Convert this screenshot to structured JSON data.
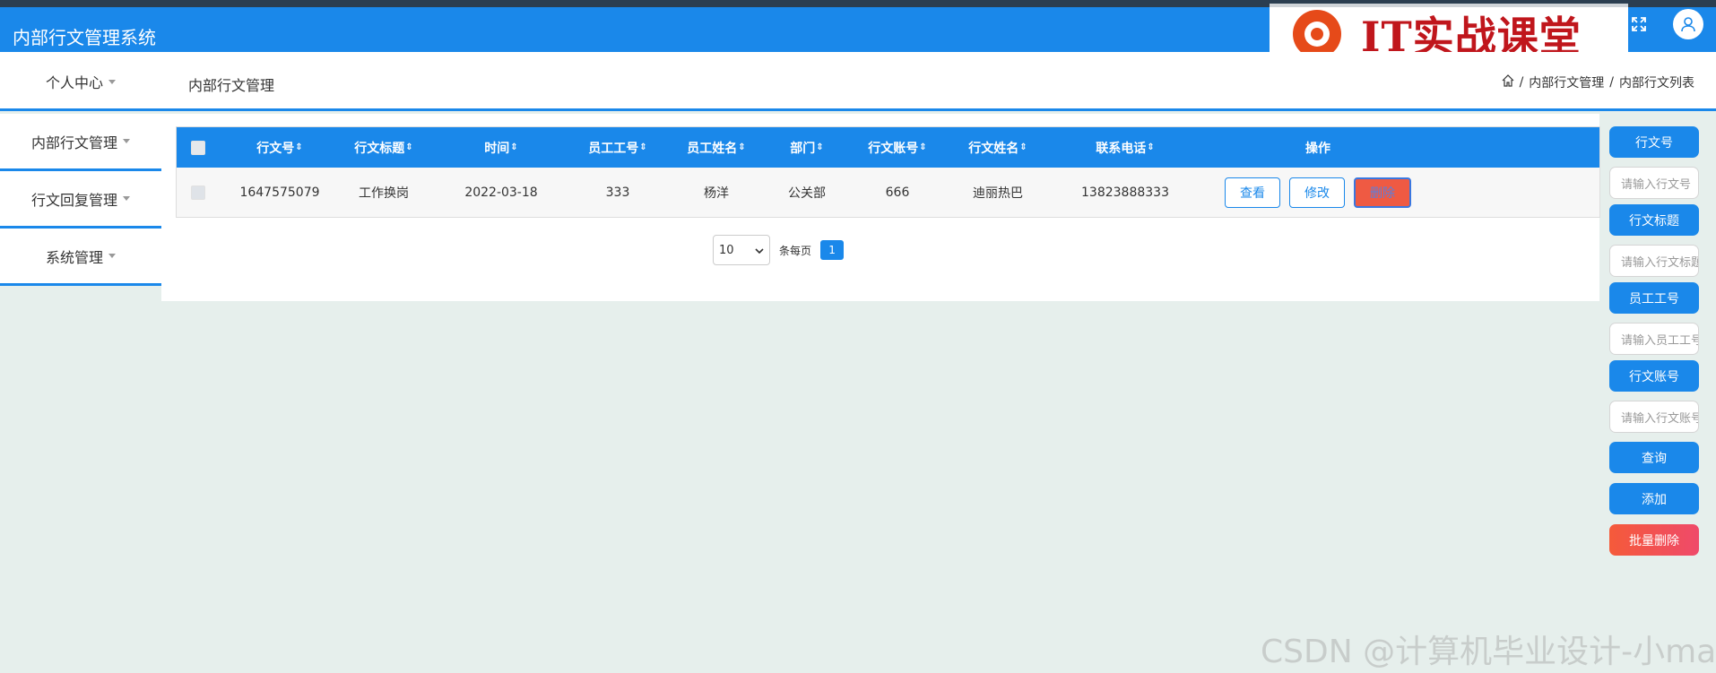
{
  "app": {
    "title": "内部行文管理系统"
  },
  "logo": {
    "text": "IT实战课堂"
  },
  "topbar": {
    "expand_icon": "expand-icon",
    "user_icon": "user-icon"
  },
  "subheader": {
    "personal_center": "个人中心",
    "section_title": "内部行文管理",
    "breadcrumb": {
      "home_icon": "home-icon",
      "level1": "内部行文管理",
      "level2": "内部行文列表",
      "separator": "/"
    }
  },
  "sidebar": {
    "items": [
      {
        "label": "内部行文管理"
      },
      {
        "label": "行文回复管理"
      },
      {
        "label": "系统管理"
      }
    ]
  },
  "table": {
    "columns": [
      "行文号",
      "行文标题",
      "时间",
      "员工工号",
      "员工姓名",
      "部门",
      "行文账号",
      "行文姓名",
      "联系电话",
      "操作"
    ],
    "rows": [
      {
        "cells": [
          "1647575079",
          "工作换岗",
          "2022-03-18",
          "333",
          "杨洋",
          "公关部",
          "666",
          "迪丽热巴",
          "13823888333"
        ],
        "actions": {
          "view": "查看",
          "edit": "修改",
          "delete": "删除"
        }
      }
    ]
  },
  "pagination": {
    "page_size": "10",
    "per_page_label": "条每页",
    "current_page": "1"
  },
  "search_panel": {
    "field1_label": "行文号",
    "field1_placeholder": "请输入行文号",
    "field2_label": "行文标题",
    "field2_placeholder": "请输入行文标题",
    "field3_label": "员工工号",
    "field3_placeholder": "请输入员工工号",
    "field4_label": "行文账号",
    "field4_placeholder": "请输入行文账号",
    "query": "查询",
    "add": "添加",
    "batch_delete": "批量删除"
  },
  "watermark": "CSDN @计算机毕业设计-小ma",
  "colors": {
    "primary": "#1a88ea",
    "danger": "#ef5a43",
    "background": "#e6efec"
  }
}
